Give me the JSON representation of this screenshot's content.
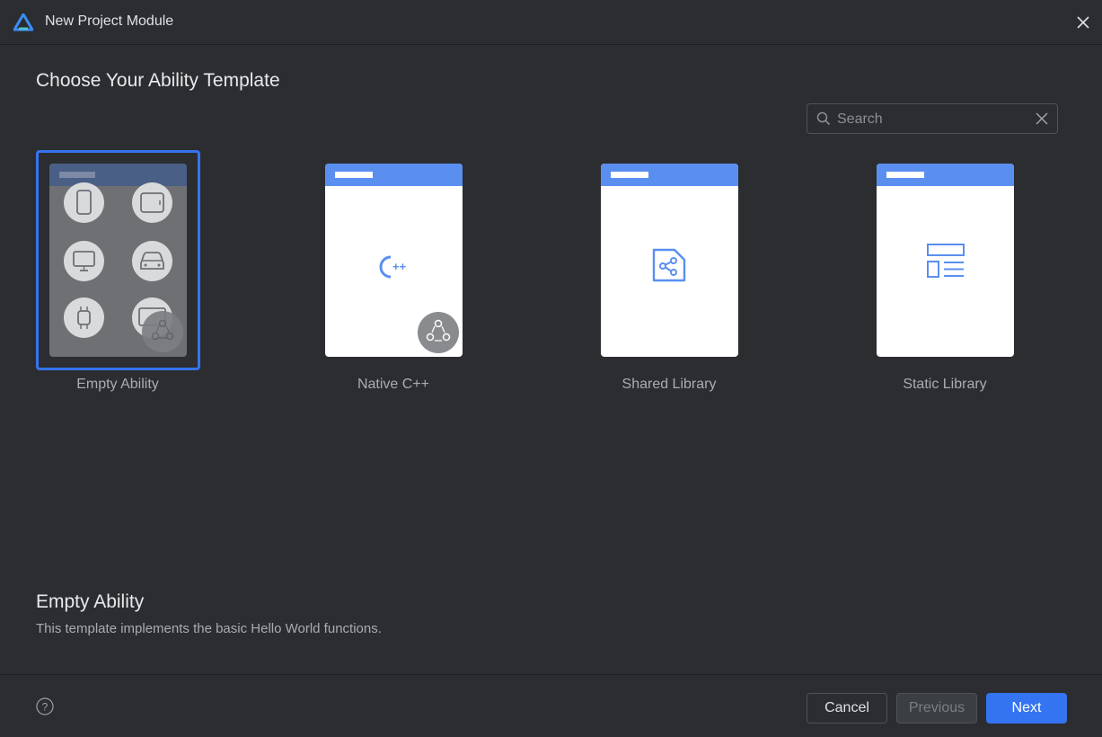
{
  "window": {
    "title": "New Project Module"
  },
  "page": {
    "heading": "Choose Your Ability Template"
  },
  "search": {
    "placeholder": "Search",
    "value": ""
  },
  "templates": [
    {
      "label": "Empty Ability",
      "selected": true
    },
    {
      "label": "Native C++",
      "selected": false
    },
    {
      "label": "Shared Library",
      "selected": false
    },
    {
      "label": "Static Library",
      "selected": false
    }
  ],
  "description": {
    "title": "Empty Ability",
    "text": "This template implements the basic Hello World functions."
  },
  "footer": {
    "cancel_label": "Cancel",
    "previous_label": "Previous",
    "next_label": "Next"
  },
  "colors": {
    "background": "#2b2d30",
    "accent": "#3574f0",
    "card_header": "#5a8ff0",
    "icon_blue": "#5a8ff0"
  }
}
